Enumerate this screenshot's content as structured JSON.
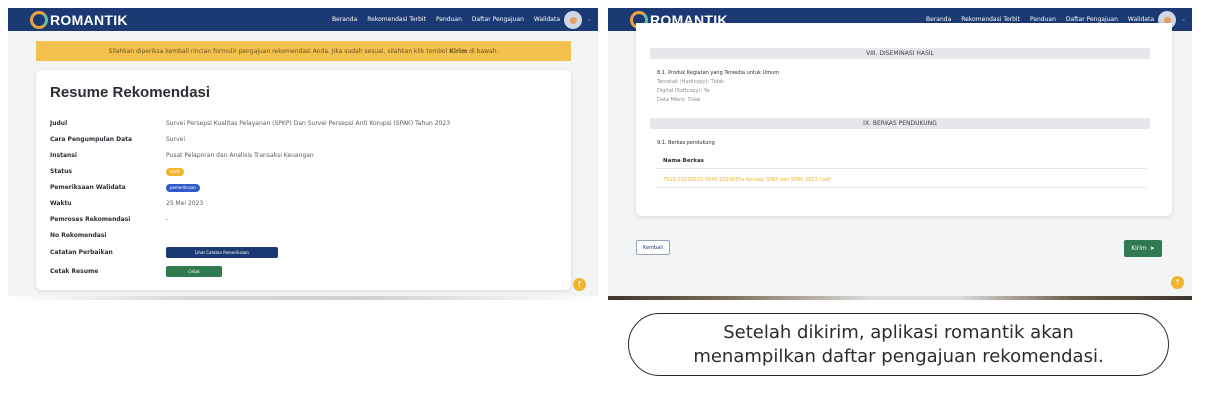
{
  "app": {
    "logo_text": "ROMANTIK",
    "nav": [
      "Beranda",
      "Rekomendasi Terbit",
      "Panduan",
      "Daftar Pengajuan",
      "Walidata"
    ],
    "colors": {
      "navbar": "#1b3a74",
      "alert": "#f2c14e",
      "accent": "#f2b32d",
      "green": "#2f7a4e"
    }
  },
  "left": {
    "alert": {
      "before": "Silahkan diperiksa kembali rincian formulir pengajuan rekomendasi Anda. Jika sudah sesuai, silahkan klik tombol",
      "bold": "Kirim",
      "after": "di bawah."
    },
    "title": "Resume Rekomendasi",
    "rows": {
      "judul": {
        "label": "Judul",
        "value": "Survei Persepsi Kualitas Pelayanan (SPKP) Dan Survei Persepsi Anti Korupsi (SPAK) Tahun 2023"
      },
      "cara": {
        "label": "Cara Pengumpulan Data",
        "value": "Survei"
      },
      "instansi": {
        "label": "Instansi",
        "value": "Pusat Pelaporan dan Analisis Transaksi Keuangan"
      },
      "status": {
        "label": "Status",
        "value": "draft"
      },
      "pemeriksaan": {
        "label": "Pemeriksaan Walidata",
        "value": "pemeriksaan"
      },
      "waktu": {
        "label": "Waktu",
        "value": "25 Mei 2023"
      },
      "pemroses": {
        "label": "Pemroses Rekomendasi",
        "value": "-"
      },
      "no": {
        "label": "No Rekomendasi",
        "value": ""
      },
      "catatan": {
        "label": "Catatan Perbaikan",
        "button": "Lihat Catatan Pemeriksaan"
      },
      "cetak": {
        "label": "Cetak Resume",
        "button": "Cetak"
      }
    }
  },
  "right": {
    "section8": "VIII. DISEMINASI HASIL",
    "produk_label": "8.1. Produk Kegiatan yang Tersedia untuk Umum",
    "produk_items": [
      "Tercetak (Hardcopy): Tidak",
      "Digital (Softcopy): Ya",
      "Data Mikro: Tidak"
    ],
    "section9": "IX. BERKAS PENDUKUNG",
    "berkas_label": "9.1. Berkas pendukung",
    "nama_berkas_header": "Nama Berkas",
    "file_name": "7519-20230525-3930-2023050x Konsep SPKP dan SPAK 2023 f.pdf",
    "kembali": "Kembali",
    "kirim": "Kirim"
  },
  "caption": {
    "line1": "Setelah dikirim, aplikasi romantik akan",
    "line2": "menampilkan daftar pengajuan rekomendasi."
  }
}
